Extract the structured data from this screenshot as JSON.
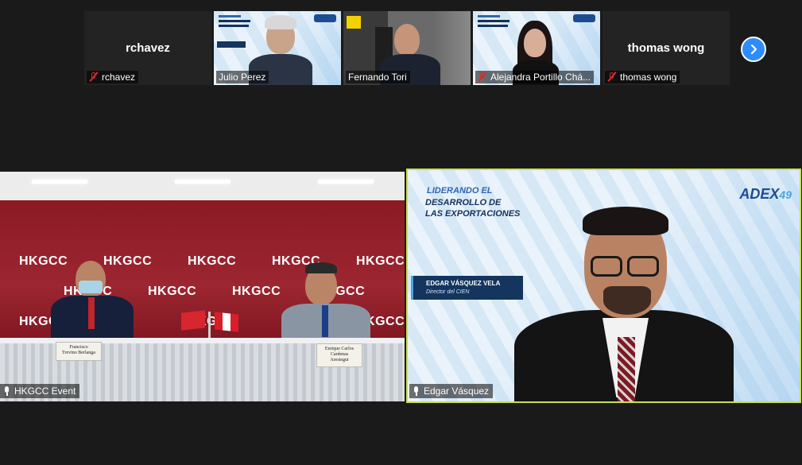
{
  "gallery": {
    "participants": [
      {
        "name": "rchavez",
        "label": "rchavez",
        "muted": true,
        "video": false
      },
      {
        "name": "Julio Perez",
        "muted": false,
        "video": true
      },
      {
        "name": "Fernando Tori",
        "muted": false,
        "video": true
      },
      {
        "name": "Alejandra Portillo Chá...",
        "muted": true,
        "video": true
      },
      {
        "name": "thomas wong",
        "label": "thomas wong",
        "muted": true,
        "video": false
      }
    ],
    "next_icon": "chevron-right-icon"
  },
  "main": {
    "left": {
      "name": "HKGCC Event",
      "backdrop_text": "HKGCC",
      "placard_left_line1": "Francisco",
      "placard_left_line2": "Trevino Berlanga",
      "placard_right_line1": "Enrique Carlos",
      "placard_right_line2": "Cardenas",
      "placard_right_line3": "Arestegui"
    },
    "right": {
      "name": "Edgar Vásquez",
      "banner_line1": "LIDERANDO EL",
      "banner_line2": "DESARROLLO DE",
      "banner_line3": "LAS EXPORTACIONES",
      "logo_text": "ADEX",
      "logo_num": "49",
      "lower_third_name": "EDGAR VÁSQUEZ VELA",
      "lower_third_role": "Director del CIEN",
      "active_speaker_color": "#c8e04a"
    }
  },
  "colors": {
    "background": "#1a1a1a",
    "accent": "#2d8cff",
    "muted": "#e02828"
  }
}
